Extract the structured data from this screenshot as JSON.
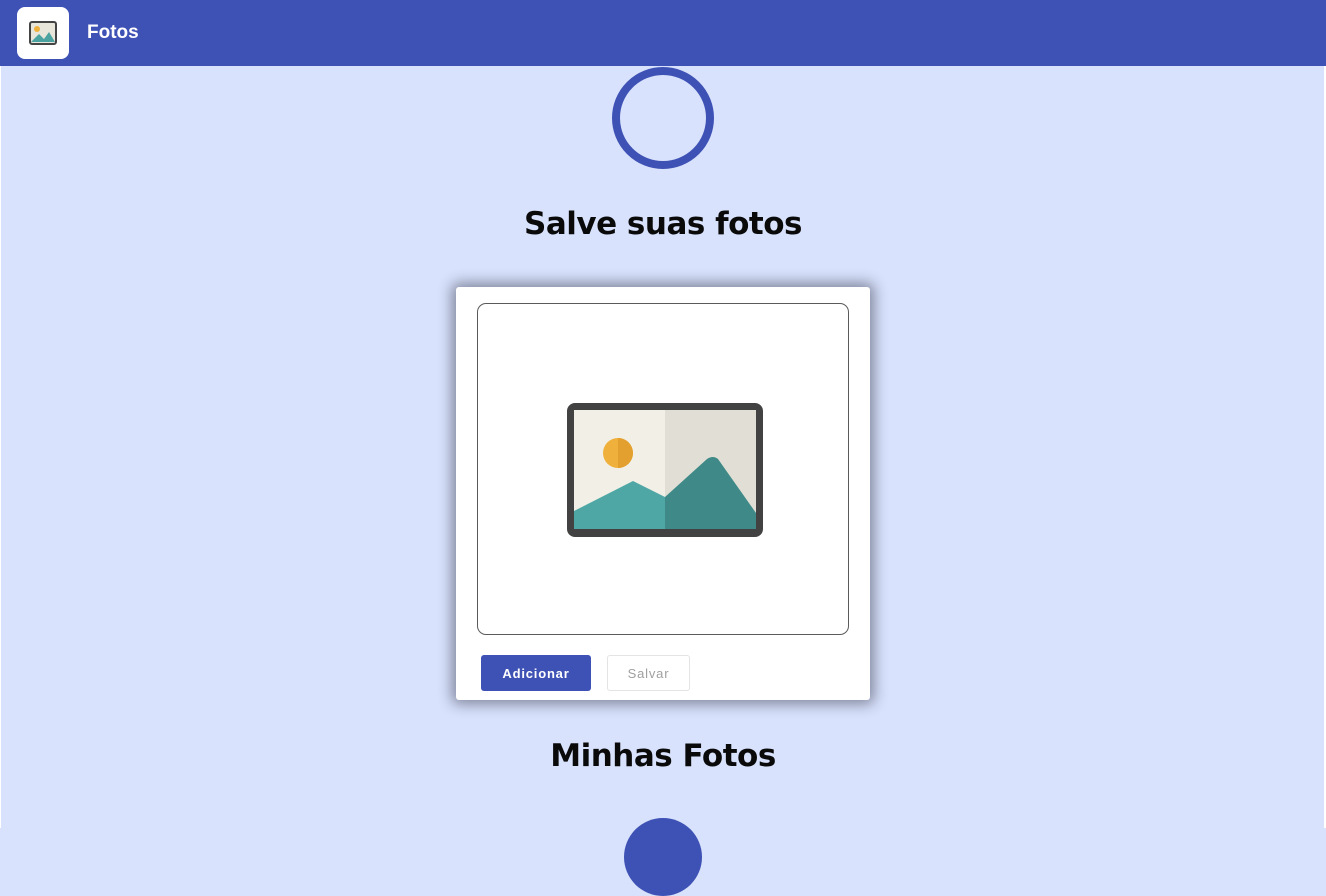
{
  "app": {
    "title": "Fotos",
    "icon": "photo-icon",
    "brand_color": "#3e51b5",
    "background_color": "#d8e2fc"
  },
  "upload_section": {
    "heading": "Salve suas fotos",
    "preview_icon": "image-placeholder-icon",
    "buttons": {
      "add_label": "Adicionar",
      "save_label": "Salvar"
    }
  },
  "gallery_section": {
    "heading": "Minhas Fotos"
  },
  "loading_spinners": [
    "loading-spinner-top",
    "loading-spinner-bottom"
  ]
}
